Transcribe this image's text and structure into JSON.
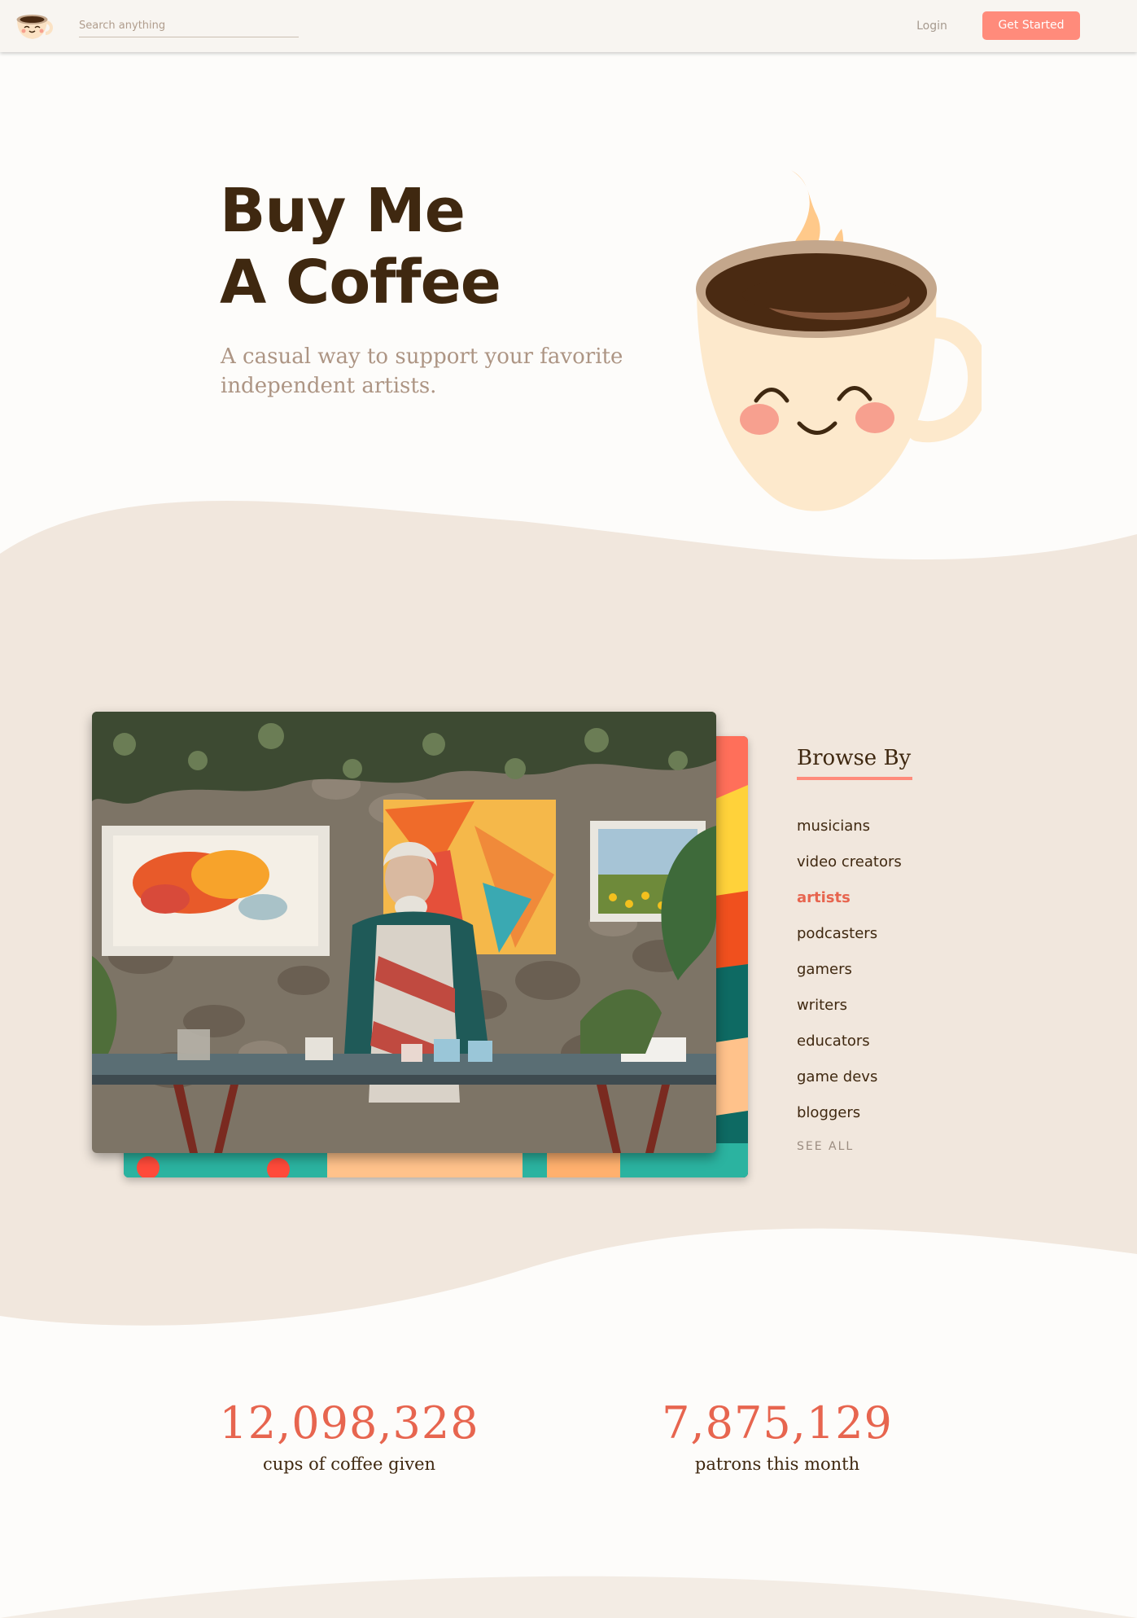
{
  "navbar": {
    "search_placeholder": "Search anything",
    "login_label": "Login",
    "cta_label": "Get Started",
    "logo_icon": "coffee-cup-mascot-icon"
  },
  "hero": {
    "title_line1": "Buy Me",
    "title_line2": "A Coffee",
    "subtitle": "A casual way to support your favorite independent artists.",
    "illustration": "smiling-coffee-cup-icon"
  },
  "browse": {
    "title": "Browse By",
    "items": [
      {
        "label": "musicians",
        "active": false
      },
      {
        "label": "video creators",
        "active": false
      },
      {
        "label": "artists",
        "active": true
      },
      {
        "label": "podcasters",
        "active": false
      },
      {
        "label": "gamers",
        "active": false
      },
      {
        "label": "writers",
        "active": false
      },
      {
        "label": "educators",
        "active": false
      },
      {
        "label": "game devs",
        "active": false
      },
      {
        "label": "bloggers",
        "active": false
      }
    ],
    "see_all_label": "SEE ALL"
  },
  "stats": [
    {
      "number": "12,098,328",
      "label": "cups of coffee given"
    },
    {
      "number": "7,875,129",
      "label": "patrons this month"
    }
  ],
  "colors": {
    "accent": "#ff8b7b",
    "accent_text": "#e7654f",
    "dark_brown": "#3f2810",
    "band_beige": "#f1e7dd",
    "page_bg": "#fdfcfa"
  }
}
